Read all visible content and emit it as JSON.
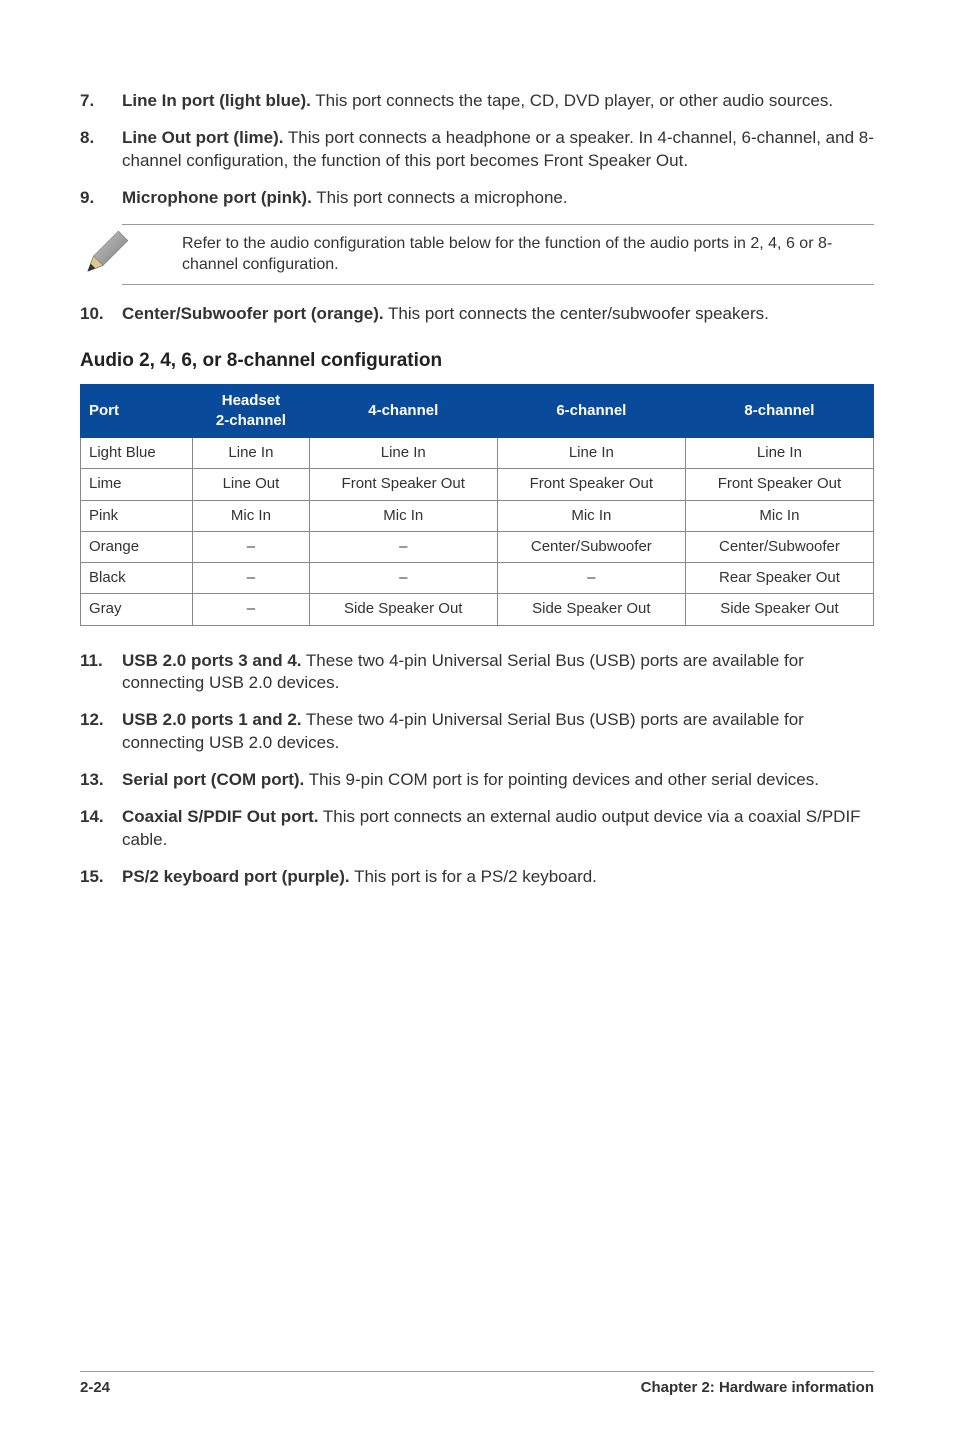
{
  "items_top": [
    {
      "num": "7.",
      "bold": "Line In port (light blue).",
      "rest": " This port connects the tape, CD, DVD player, or other audio sources."
    },
    {
      "num": "8.",
      "bold": "Line Out port (lime).",
      "rest": " This port connects a headphone or a speaker. In 4-channel, 6-channel, and 8-channel configuration, the function of this port becomes Front Speaker Out."
    },
    {
      "num": "9.",
      "bold": "Microphone port (pink).",
      "rest": " This port connects a microphone."
    }
  ],
  "note": "Refer to the audio configuration table below for the function of the audio ports in 2, 4, 6 or 8-channel configuration.",
  "item10": {
    "num": "10.",
    "bold": "Center/Subwoofer port (orange).",
    "rest": " This port connects the center/subwoofer speakers."
  },
  "table_heading": "Audio 2, 4, 6, or 8-channel configuration",
  "table": {
    "headers": [
      "Port",
      "Headset\n2-channel",
      "4-channel",
      "6-channel",
      "8-channel"
    ],
    "rows": [
      [
        "Light Blue",
        "Line In",
        "Line In",
        "Line In",
        "Line In"
      ],
      [
        "Lime",
        "Line Out",
        "Front Speaker Out",
        "Front Speaker Out",
        "Front Speaker Out"
      ],
      [
        "Pink",
        "Mic In",
        "Mic In",
        "Mic In",
        "Mic In"
      ],
      [
        "Orange",
        "–",
        "–",
        "Center/Subwoofer",
        "Center/Subwoofer"
      ],
      [
        "Black",
        "–",
        "–",
        "–",
        "Rear Speaker Out"
      ],
      [
        "Gray",
        "–",
        "Side Speaker Out",
        "Side Speaker Out",
        "Side Speaker Out"
      ]
    ]
  },
  "items_bottom": [
    {
      "num": "11.",
      "bold": "USB 2.0 ports 3 and 4.",
      "rest": " These two 4-pin Universal Serial Bus (USB) ports are available for connecting USB 2.0 devices."
    },
    {
      "num": "12.",
      "bold": "USB 2.0 ports 1 and 2.",
      "rest": " These two 4-pin Universal Serial Bus (USB) ports are available for connecting USB 2.0 devices."
    },
    {
      "num": "13.",
      "bold": "Serial port (COM port).",
      "rest": " This 9-pin COM port is for pointing devices and other serial devices."
    },
    {
      "num": "14.",
      "bold": "Coaxial S/PDIF Out port.",
      "rest": " This port connects an external audio output device via a coaxial S/PDIF cable."
    },
    {
      "num": "15.",
      "bold": "PS/2 keyboard port (purple).",
      "rest": " This port is for a PS/2 keyboard."
    }
  ],
  "footer_left": "2-24",
  "footer_right": "Chapter 2: Hardware information"
}
